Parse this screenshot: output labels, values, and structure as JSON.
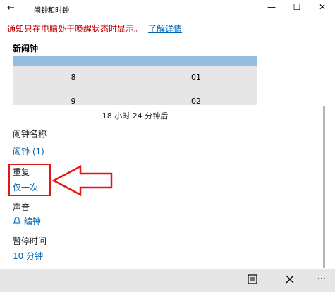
{
  "window": {
    "title": "闹钟和时钟",
    "back_label": "←",
    "minimize_label": "—",
    "maximize_label": "☐",
    "close_label": "✕"
  },
  "notice": {
    "text": "通知只在电脑处于唤醒状态时显示。",
    "link": "了解详情"
  },
  "section_title": "新闹钟",
  "picker": {
    "hours": [
      "8",
      "9"
    ],
    "minutes": [
      "01",
      "02"
    ]
  },
  "duration_text": "18 小时 24 分钟后",
  "fields": {
    "name_label": "闹钟名称",
    "name_value": "闹钟 (1)",
    "repeat_label": "重复",
    "repeat_value": "仅一次",
    "sound_label": "声音",
    "sound_value": "编钟",
    "snooze_label": "暂停时间",
    "snooze_value": "10 分钟"
  },
  "colors": {
    "accent": "#0063b1",
    "warning": "#c00000",
    "annotation": "#e01818"
  },
  "icons": {
    "bell": "bell-icon",
    "save": "save-icon",
    "cancel": "close-icon"
  }
}
